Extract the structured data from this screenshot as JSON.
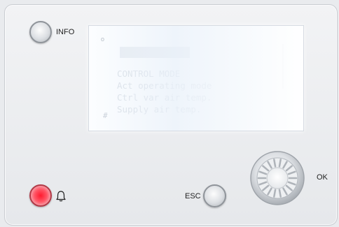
{
  "controls": {
    "info_label": "INFO",
    "esc_label": "ESC",
    "ok_label": "OK"
  },
  "display": {
    "dots": "o",
    "lines": [
      "CONTROL MODE",
      "Act operating mode",
      "Ctrl var air temp.",
      "Supply air temp."
    ],
    "marker": "#"
  },
  "icons": {
    "alarm": "bell-icon",
    "knob": "rotary-knob-icon"
  },
  "colors": {
    "alarm_red": "#ff1a2e",
    "panel_bg": "#eceef1"
  }
}
